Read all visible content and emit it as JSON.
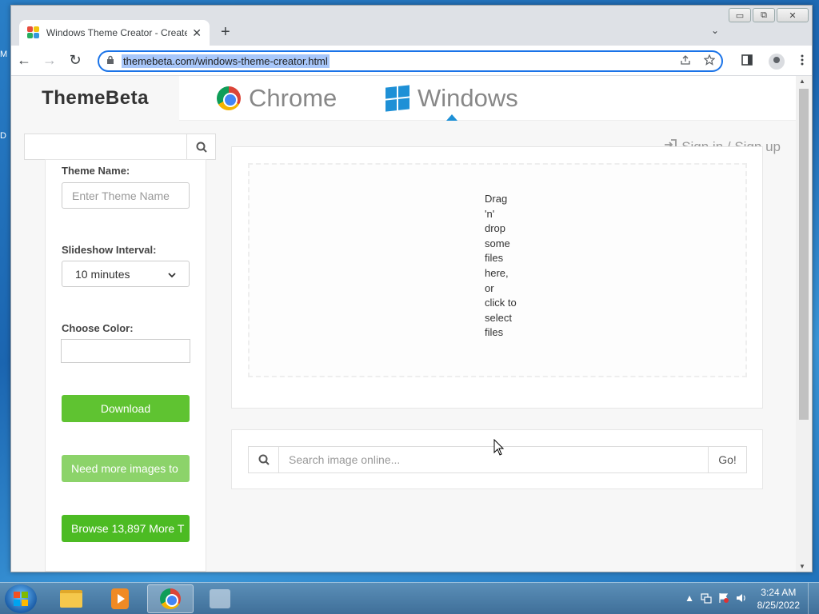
{
  "desktop": {
    "peek_1": "M",
    "peek_2": "D"
  },
  "window": {
    "minimize_label": "▭",
    "maximize_label": "⧉",
    "close_label": "✕"
  },
  "browser": {
    "tab_title": "Windows Theme Creator - Create",
    "tab_close": "✕",
    "new_tab": "+",
    "tab_search": "⌄",
    "back": "←",
    "forward": "→",
    "reload": "↻",
    "url": "themebeta.com/windows-theme-creator.html"
  },
  "site": {
    "brand": "ThemeBeta",
    "nav": [
      {
        "label": "Chrome"
      },
      {
        "label": "Windows"
      }
    ],
    "signin": "Sign in / Sign up"
  },
  "sidebar": {
    "search_placeholder": "",
    "theme_name_label": "Theme Name:",
    "theme_name_placeholder": "Enter Theme Name",
    "slideshow_label": "Slideshow Interval:",
    "slideshow_value": "10 minutes",
    "color_label": "Choose Color:",
    "download_button": "Download",
    "more_images_button": "Need more images to",
    "browse_button": "Browse 13,897 More T"
  },
  "dropzone": {
    "text": "Drag 'n' drop some files here, or click to select files"
  },
  "image_search": {
    "placeholder": "Search image online...",
    "go_button": "Go!"
  },
  "taskbar": {
    "time": "3:24 AM",
    "date": "8/25/2022"
  }
}
